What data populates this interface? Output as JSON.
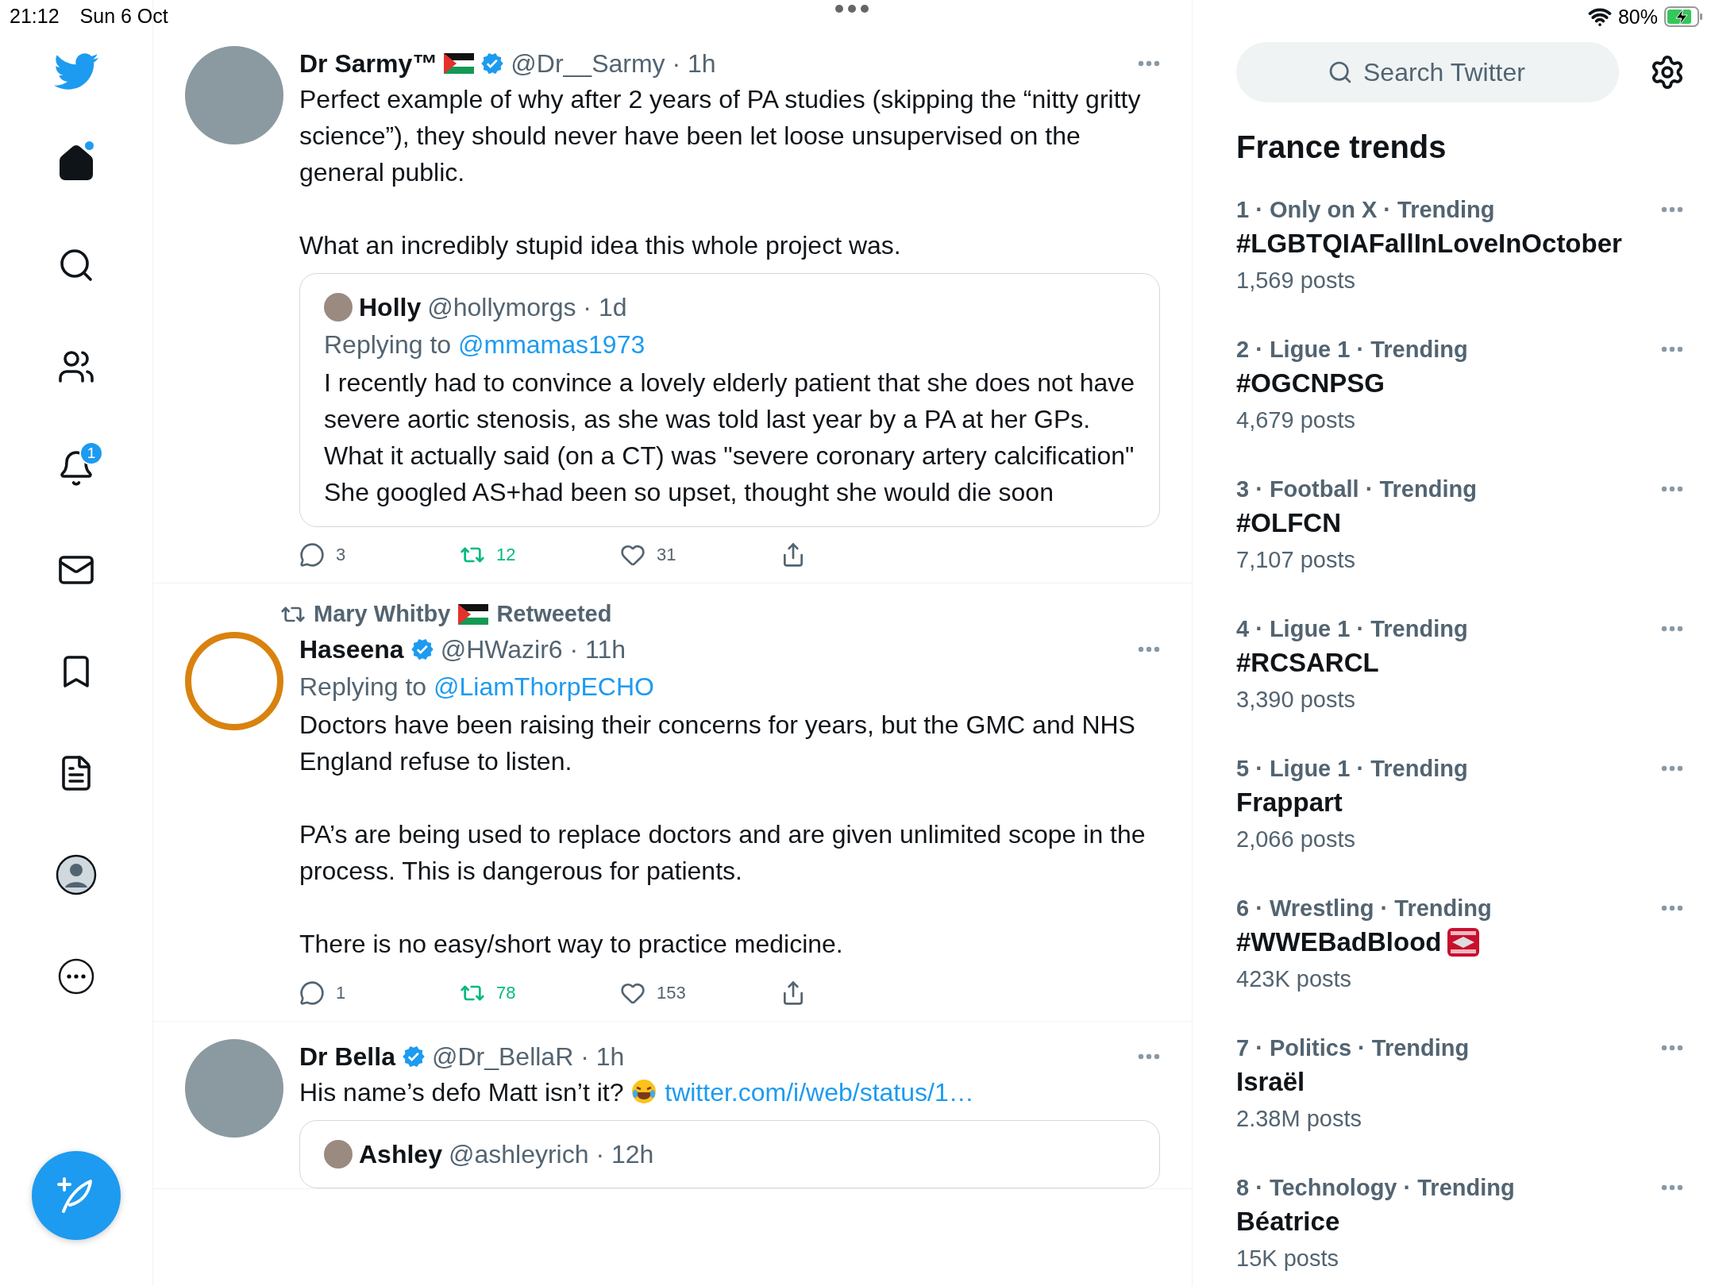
{
  "status_bar": {
    "time": "21:12",
    "date": "Sun 6 Oct",
    "battery": "80%",
    "charging": true
  },
  "sidebar": {
    "items": [
      {
        "kind": "home",
        "selected": true,
        "has_update": true
      },
      {
        "kind": "explore",
        "selected": false
      },
      {
        "kind": "communities",
        "selected": false
      },
      {
        "kind": "notifications",
        "selected": false,
        "badge": "1"
      },
      {
        "kind": "messages",
        "selected": false
      },
      {
        "kind": "bookmarks",
        "selected": false
      },
      {
        "kind": "lists",
        "selected": false
      },
      {
        "kind": "profile",
        "selected": false
      },
      {
        "kind": "more",
        "selected": false
      }
    ]
  },
  "timeline": [
    {
      "name": "Dr Sarmy™",
      "flag": true,
      "verified": true,
      "meta": "@Dr__Sarmy · 1h",
      "avatar_logo": false,
      "paragraphs": [
        "Perfect example of why after 2 years of PA studies (skipping the “nitty gritty science”), they should never have been let loose unsupervised on the general public.",
        "What an incredibly stupid idea this whole project was."
      ],
      "quote": {
        "name": "Holly",
        "meta": "@hollymorgs · 1d",
        "replying_label": "Replying to",
        "replying_to": "@mmamas1973",
        "lines": [
          "I recently had to convince a lovely elderly patient that she does not have severe aortic stenosis, as she was told last year by a PA at her GPs. What it actually said (on a CT) was \"severe coronary artery calcification\"",
          "She googled AS+had been so upset, thought she would die soon"
        ]
      },
      "stats": [
        {
          "kind": "reply",
          "count": "3",
          "active": false
        },
        {
          "kind": "retweet",
          "count": "12",
          "active": true
        },
        {
          "kind": "like",
          "count": "31",
          "active": false
        },
        {
          "kind": "share",
          "active": false
        }
      ]
    },
    {
      "retweeted_by": "Mary Whitby",
      "retweeted_flag": true,
      "retweeted_label": "Retweeted",
      "name": "Haseena",
      "verified": true,
      "meta": "@HWazir6 · 11h",
      "avatar_logo": true,
      "replying_label": "Replying to",
      "replying_to": "@LiamThorpECHO",
      "paragraphs": [
        "Doctors have been raising their concerns for years, but the GMC and NHS England refuse to listen.",
        "PA’s are being used to replace doctors and are given unlimited scope in the process. This is dangerous for patients.",
        "There is no easy/short way to practice medicine."
      ],
      "stats": [
        {
          "kind": "reply",
          "count": "1",
          "active": false
        },
        {
          "kind": "retweet",
          "count": "78",
          "active": true
        },
        {
          "kind": "like",
          "count": "153",
          "active": false
        },
        {
          "kind": "share",
          "active": false
        }
      ]
    },
    {
      "name": "Dr Bella",
      "verified": true,
      "meta": "@Dr_BellaR · 1h",
      "avatar_logo": false,
      "text": "His name’s defo Matt isn’t it?",
      "emoji": true,
      "link": "twitter.com/i/web/status/1…",
      "quote": {
        "name": "Ashley",
        "meta": "@ashleyrich · 12h"
      }
    }
  ],
  "search": {
    "placeholder": "Search Twitter"
  },
  "trends": {
    "title": "France trends",
    "items": [
      {
        "meta": "1 · Only on X · Trending",
        "name": "#LGBTQIAFallInLoveInOctober",
        "posts": "1,569 posts"
      },
      {
        "meta": "2 · Ligue 1 · Trending",
        "name": "#OGCNPSG",
        "posts": "4,679 posts"
      },
      {
        "meta": "3 · Football · Trending",
        "name": "#OLFCN",
        "posts": "7,107 posts"
      },
      {
        "meta": "4 · Ligue 1 · Trending",
        "name": "#RCSARCL",
        "posts": "3,390 posts"
      },
      {
        "meta": "5 · Ligue 1 · Trending",
        "name": "Frappart",
        "posts": "2,066 posts"
      },
      {
        "meta": "6 · Wrestling · Trending",
        "name": "#WWEBadBlood",
        "posts": "423K posts",
        "badge": true
      },
      {
        "meta": "7 · Politics · Trending",
        "name": "Israël",
        "posts": "2.38M posts"
      },
      {
        "meta": "8 · Technology · Trending",
        "name": "Béatrice",
        "posts": "15K posts"
      }
    ]
  }
}
